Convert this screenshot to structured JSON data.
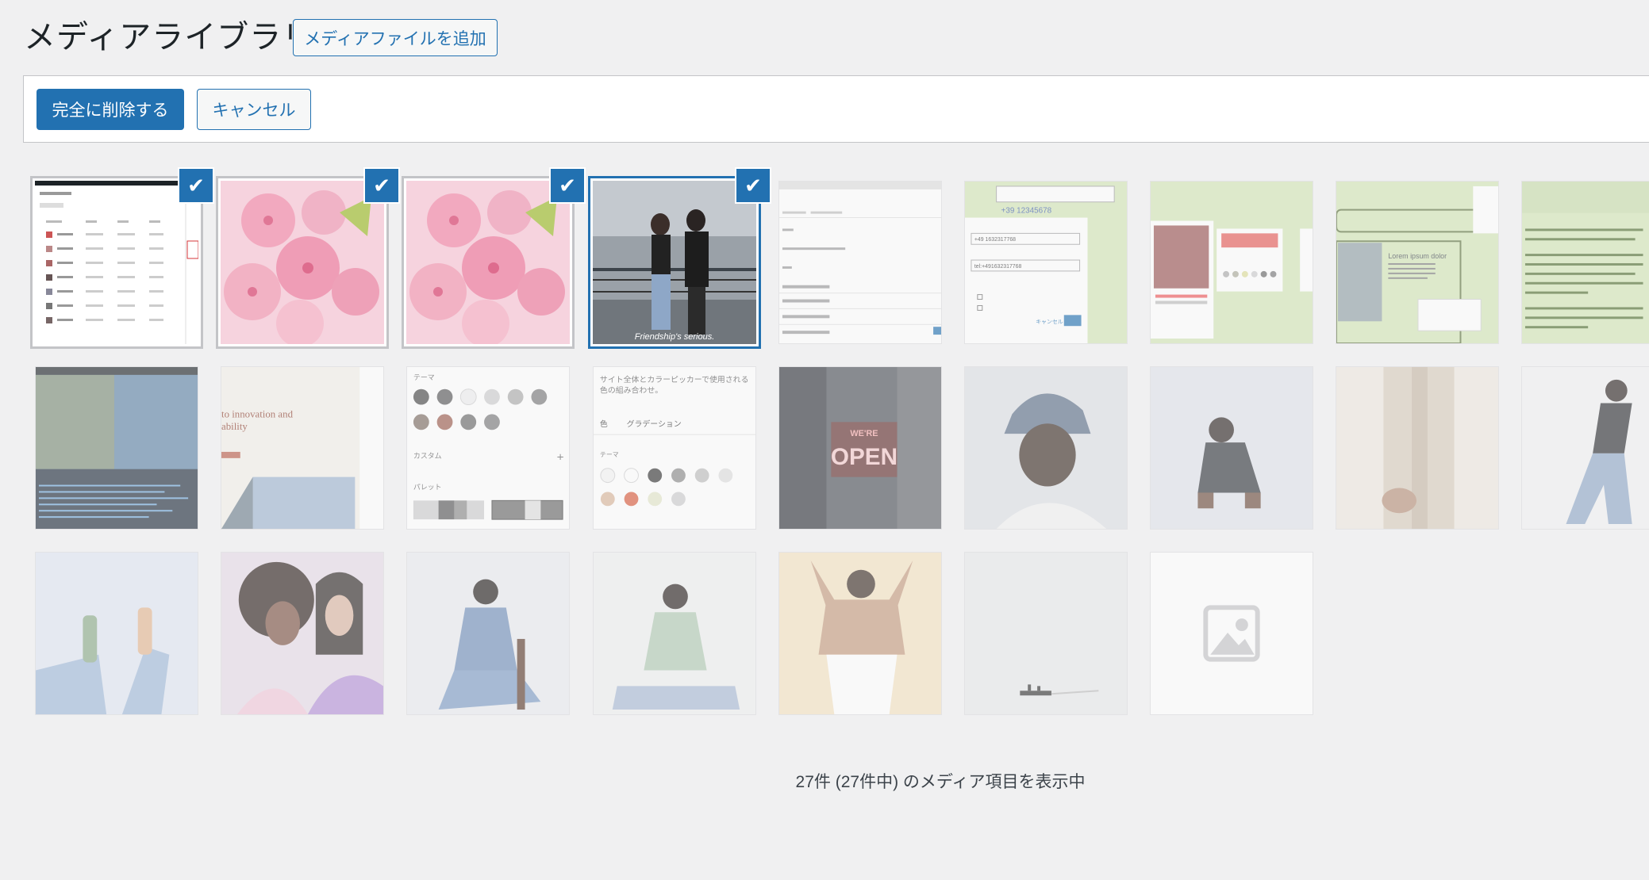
{
  "page": {
    "title": "メディアライブラリ",
    "add_button": "メディアファイルを追加"
  },
  "toolbar": {
    "delete_label": "完全に削除する",
    "cancel_label": "キャンセル"
  },
  "thumbnails": {
    "t4_caption": "Friendship's serious.",
    "t6_phone": "+39 12345678",
    "t6_field1": "+49 1632317768",
    "t6_field2": "tel:+491632317768",
    "t6_cancel": "キャンセル",
    "t9_text": "Lorem ipsum dolor",
    "t13_heading": "テーマ",
    "t13_custom": "カスタム",
    "t13_palette": "パレット",
    "t14_desc": "サイト全体とカラーピッカーで使用される色の組み合わせ。",
    "t14_tab1": "色",
    "t14_tab2": "グラデーション",
    "t14_theme": "テーマ",
    "t15_sign": "OPEN",
    "t15_sign_top": "WE'RE",
    "t11_heading": "to innovation and",
    "t11_heading2": "ability"
  },
  "status": "27件 (27件中) のメディア項目を表示中",
  "colors": {
    "accent": "#2271b1",
    "background": "#f0f0f1"
  }
}
